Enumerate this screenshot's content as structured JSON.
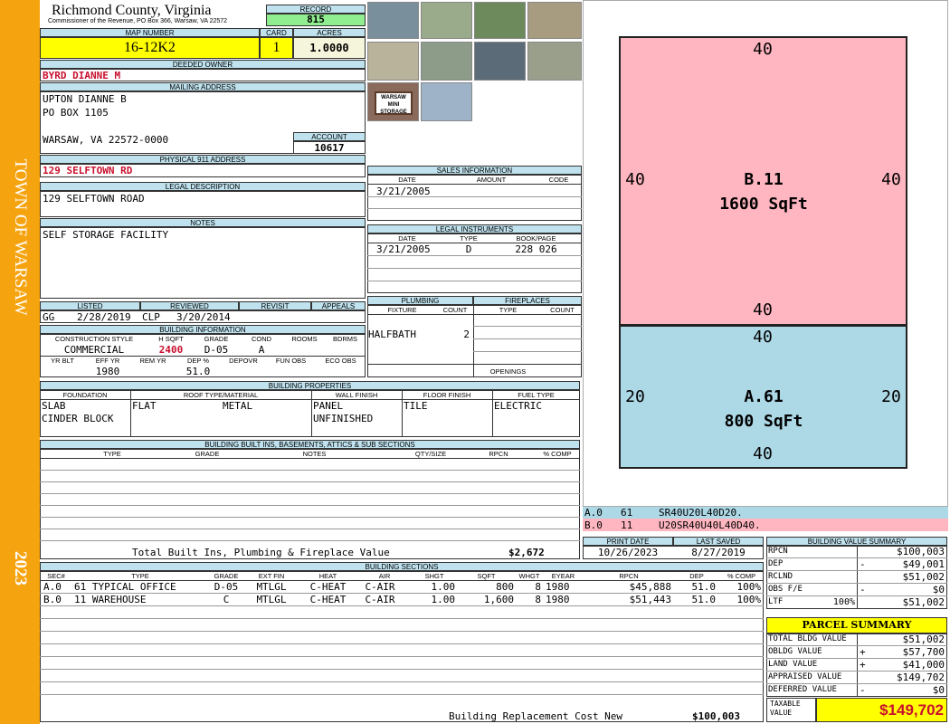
{
  "sidebar": {
    "town": "TOWN OF WARSAW",
    "year": "2023"
  },
  "header": {
    "county": "Richmond County, Virginia",
    "commissioner": "Commissioner of the Revenue, PO Box 366, Warsaw, VA 22572",
    "record_label": "RECORD",
    "record": "815",
    "map_label": "MAP NUMBER",
    "map_number": "16-12K2",
    "card_label": "CARD",
    "card": "1",
    "acres_label": "ACRES",
    "acres": "1.0000"
  },
  "owner": {
    "deeded_label": "DEEDED OWNER",
    "deeded": "BYRD DIANNE M",
    "mailing_label": "MAILING ADDRESS",
    "line1": "UPTON DIANNE B",
    "line2": "PO BOX 1105",
    "line3": "WARSAW, VA 22572-0000",
    "account_label": "ACCOUNT",
    "account": "10617",
    "physical_label": "PHYSICAL 911 ADDRESS",
    "physical": "129 SELFTOWN RD"
  },
  "legal": {
    "label": "LEGAL DESCRIPTION",
    "text": "129 SELFTOWN ROAD"
  },
  "notes": {
    "label": "NOTES",
    "text": "SELF STORAGE FACILITY"
  },
  "sales": {
    "label": "SALES INFORMATION",
    "cols": [
      "DATE",
      "AMOUNT",
      "CODE"
    ],
    "rows": [
      [
        "3/21/2005",
        "",
        ""
      ]
    ]
  },
  "instruments": {
    "label": "LEGAL INSTRUMENTS",
    "cols": [
      "DATE",
      "TYPE",
      "BOOK/PAGE"
    ],
    "rows": [
      [
        "3/21/2005",
        "D",
        "228 026"
      ]
    ]
  },
  "listed": {
    "listed_label": "LISTED",
    "reviewed_label": "REVIEWED",
    "revisit_label": "REVISIT",
    "appeals_label": "APPEALS",
    "listed_by": "GG",
    "listed_date": "2/28/2019",
    "reviewed_by": "CLP",
    "reviewed_date": "3/20/2014"
  },
  "building_info": {
    "label": "BUILDING INFORMATION",
    "cols": [
      "CONSTRUCTION STYLE",
      "H SQFT",
      "GRADE",
      "COND",
      "ROOMS",
      "BDRMS"
    ],
    "style": "COMMERCIAL",
    "hsqft": "2400",
    "grade": "D-05",
    "cond": "A",
    "cols2": [
      "YR BLT",
      "EFF YR",
      "REM YR",
      "DEP %",
      "DEPOVR",
      "FUN OBS",
      "ECO OBS"
    ],
    "eff_yr": "1980",
    "dep": "51.0"
  },
  "plumbing": {
    "label": "PLUMBING",
    "cols": [
      "FIXTURE",
      "COUNT"
    ],
    "fixture": "HALFBATH",
    "count": "2"
  },
  "fireplaces": {
    "label": "FIREPLACES",
    "cols": [
      "TYPE",
      "COUNT"
    ],
    "openings": "OPENINGS"
  },
  "properties": {
    "label": "BUILDING PROPERTIES",
    "cols": [
      "FOUNDATION",
      "ROOF TYPE/MATERIAL",
      "WALL FINISH",
      "FLOOR FINISH",
      "FUEL TYPE"
    ],
    "foundation1": "SLAB",
    "foundation2": "CINDER BLOCK",
    "roof_type": "FLAT",
    "roof_mat": "METAL",
    "wall1": "PANEL",
    "wall2": "UNFINISHED",
    "floor": "TILE",
    "fuel": "ELECTRIC"
  },
  "builtins": {
    "label": "BUILDING BUILT INS, BASEMENTS, ATTICS & SUB SECTIONS",
    "cols": [
      "TYPE",
      "GRADE",
      "NOTES",
      "QTY/SIZE",
      "RPCN",
      "% COMP"
    ],
    "total_label": "Total Built Ins, Plumbing & Fireplace Value",
    "total": "$2,672"
  },
  "sketch": {
    "b_top": "40",
    "b_left": "40",
    "b_right": "40",
    "b_bottom": "40",
    "b_name": "B.11",
    "b_area": "1600 SqFt",
    "a_top": "40",
    "a_left": "20",
    "a_right": "20",
    "a_bottom": "40",
    "a_name": "A.61",
    "a_area": "800 SqFt",
    "legend": [
      {
        "id": "A.0",
        "num": "61",
        "code": "SR40U20L40D20."
      },
      {
        "id": "B.0",
        "num": "11",
        "code": "U20SR40U40L40D40."
      }
    ]
  },
  "dates": {
    "print_label": "PRINT DATE",
    "print": "10/26/2023",
    "saved_label": "LAST SAVED",
    "saved": "8/27/2019"
  },
  "sections": {
    "label": "BUILDING SECTIONS",
    "cols": [
      "SEC#",
      "TYPE",
      "GRADE",
      "EXT FIN",
      "HEAT",
      "AIR",
      "SHGT",
      "SQFT",
      "WHGT",
      "EYEAR",
      "RPCN",
      "DEP",
      "% COMP"
    ],
    "rows": [
      [
        "A.0",
        "61 TYPICAL OFFICE",
        "D-05",
        "MTLGL",
        "C-HEAT",
        "C-AIR",
        "1.00",
        "800",
        "8",
        "1980",
        "$45,888",
        "51.0",
        "100%"
      ],
      [
        "B.0",
        "11 WAREHOUSE",
        "C",
        "MTLGL",
        "C-HEAT",
        "C-AIR",
        "1.00",
        "1,600",
        "8",
        "1980",
        "$51,443",
        "51.0",
        "100%"
      ]
    ],
    "total_label": "Building Replacement Cost New",
    "total": "$100,003"
  },
  "bvs": {
    "label": "BUILDING VALUE SUMMARY",
    "rows": [
      {
        "k": "RPCN",
        "s": "",
        "v": "$100,003"
      },
      {
        "k": "DEP",
        "s": "-",
        "v": "$49,001"
      },
      {
        "k": "RCLND",
        "s": "",
        "v": "$51,002"
      },
      {
        "k": "OBS F/E",
        "s": "-",
        "v": "$0"
      },
      {
        "k": "LTF",
        "p": "100%",
        "s": "",
        "v": "$51,002"
      }
    ]
  },
  "parcel": {
    "label": "PARCEL SUMMARY",
    "rows": [
      {
        "k": "TOTAL BLDG VALUE",
        "s": "",
        "v": "$51,002"
      },
      {
        "k": "OBLDG VALUE",
        "s": "+",
        "v": "$57,700"
      },
      {
        "k": "LAND VALUE",
        "s": "+",
        "v": "$41,000"
      },
      {
        "k": "APPRAISED VALUE",
        "s": "",
        "v": "$149,702"
      },
      {
        "k": "DEFERRED VALUE",
        "s": "-",
        "v": "$0"
      }
    ],
    "taxable_label": "TAXABLE VALUE",
    "taxable": "$149,702"
  },
  "photos": {
    "sign_text": "WARSAW MINI STORAGE"
  }
}
